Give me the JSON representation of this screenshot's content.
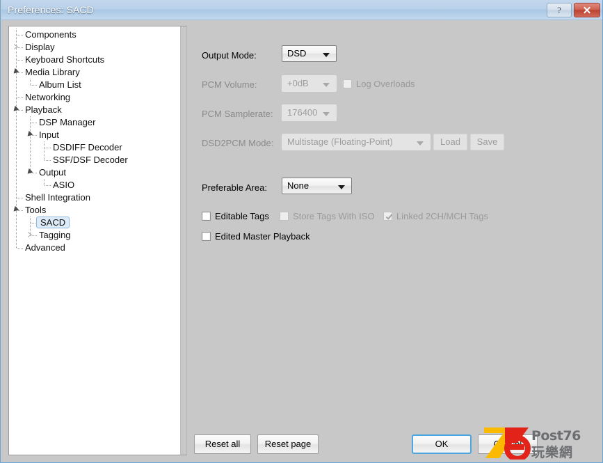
{
  "window": {
    "title": "Preferences: SACD",
    "help_button": "?",
    "close_button": "✕"
  },
  "sidebar": {
    "items": [
      {
        "label": "Components",
        "depth": 0,
        "expander": "none",
        "selected": false
      },
      {
        "label": "Display",
        "depth": 0,
        "expander": "closed",
        "selected": false
      },
      {
        "label": "Keyboard Shortcuts",
        "depth": 0,
        "expander": "none",
        "selected": false
      },
      {
        "label": "Media Library",
        "depth": 0,
        "expander": "open",
        "selected": false
      },
      {
        "label": "Album List",
        "depth": 1,
        "expander": "none",
        "selected": false
      },
      {
        "label": "Networking",
        "depth": 0,
        "expander": "none",
        "selected": false
      },
      {
        "label": "Playback",
        "depth": 0,
        "expander": "open",
        "selected": false
      },
      {
        "label": "DSP Manager",
        "depth": 1,
        "expander": "none",
        "selected": false
      },
      {
        "label": "Input",
        "depth": 1,
        "expander": "open",
        "selected": false
      },
      {
        "label": "DSDIFF Decoder",
        "depth": 2,
        "expander": "none",
        "selected": false
      },
      {
        "label": "SSF/DSF Decoder",
        "depth": 2,
        "expander": "none",
        "selected": false
      },
      {
        "label": "Output",
        "depth": 1,
        "expander": "open",
        "selected": false
      },
      {
        "label": "ASIO",
        "depth": 2,
        "expander": "none",
        "selected": false
      },
      {
        "label": "Shell Integration",
        "depth": 0,
        "expander": "none",
        "selected": false
      },
      {
        "label": "Tools",
        "depth": 0,
        "expander": "open",
        "selected": false
      },
      {
        "label": "SACD",
        "depth": 1,
        "expander": "none",
        "selected": true
      },
      {
        "label": "Tagging",
        "depth": 1,
        "expander": "closed",
        "selected": false
      },
      {
        "label": "Advanced",
        "depth": 0,
        "expander": "none",
        "selected": false
      }
    ]
  },
  "form": {
    "output_mode": {
      "label": "Output Mode:",
      "value": "DSD",
      "disabled": false
    },
    "pcm_volume": {
      "label": "PCM Volume:",
      "value": "+0dB",
      "disabled": true
    },
    "log_overloads": {
      "label": "Log Overloads",
      "checked": false,
      "disabled": true
    },
    "pcm_samplerate": {
      "label": "PCM Samplerate:",
      "value": "176400",
      "disabled": true
    },
    "dsd2pcm_mode": {
      "label": "DSD2PCM Mode:",
      "value": "Multistage (Floating-Point)",
      "disabled": true
    },
    "load_button": {
      "label": "Load",
      "disabled": true
    },
    "save_button": {
      "label": "Save",
      "disabled": true
    },
    "preferable_area": {
      "label": "Preferable Area:",
      "value": "None",
      "disabled": false
    },
    "checkboxes": [
      {
        "label": "Editable Tags",
        "checked": false,
        "disabled": false
      },
      {
        "label": "Store Tags With ISO",
        "checked": false,
        "disabled": true
      },
      {
        "label": "Linked 2CH/MCH Tags",
        "checked": true,
        "disabled": true
      },
      {
        "label": "Edited Master Playback",
        "checked": false,
        "disabled": false
      }
    ]
  },
  "footer": {
    "reset_all": "Reset all",
    "reset_page": "Reset page",
    "ok": "OK",
    "cancel": "Cancel"
  },
  "watermark": {
    "brand": "Post76",
    "brand_cn": "玩樂網",
    "number": "76"
  },
  "colors": {
    "titlebar_start": "#c3d7ec",
    "titlebar_end": "#c4daf0",
    "window_bg": "#c8c8c8",
    "accent_focus": "#4ea6e0",
    "close_red": "#bd4231",
    "selection_blue": "#ddeaf7",
    "tree_bg": "#ffffff",
    "watermark_red": "#e2231a",
    "watermark_yellow": "#fbb900",
    "watermark_grey": "#6d6e71"
  }
}
